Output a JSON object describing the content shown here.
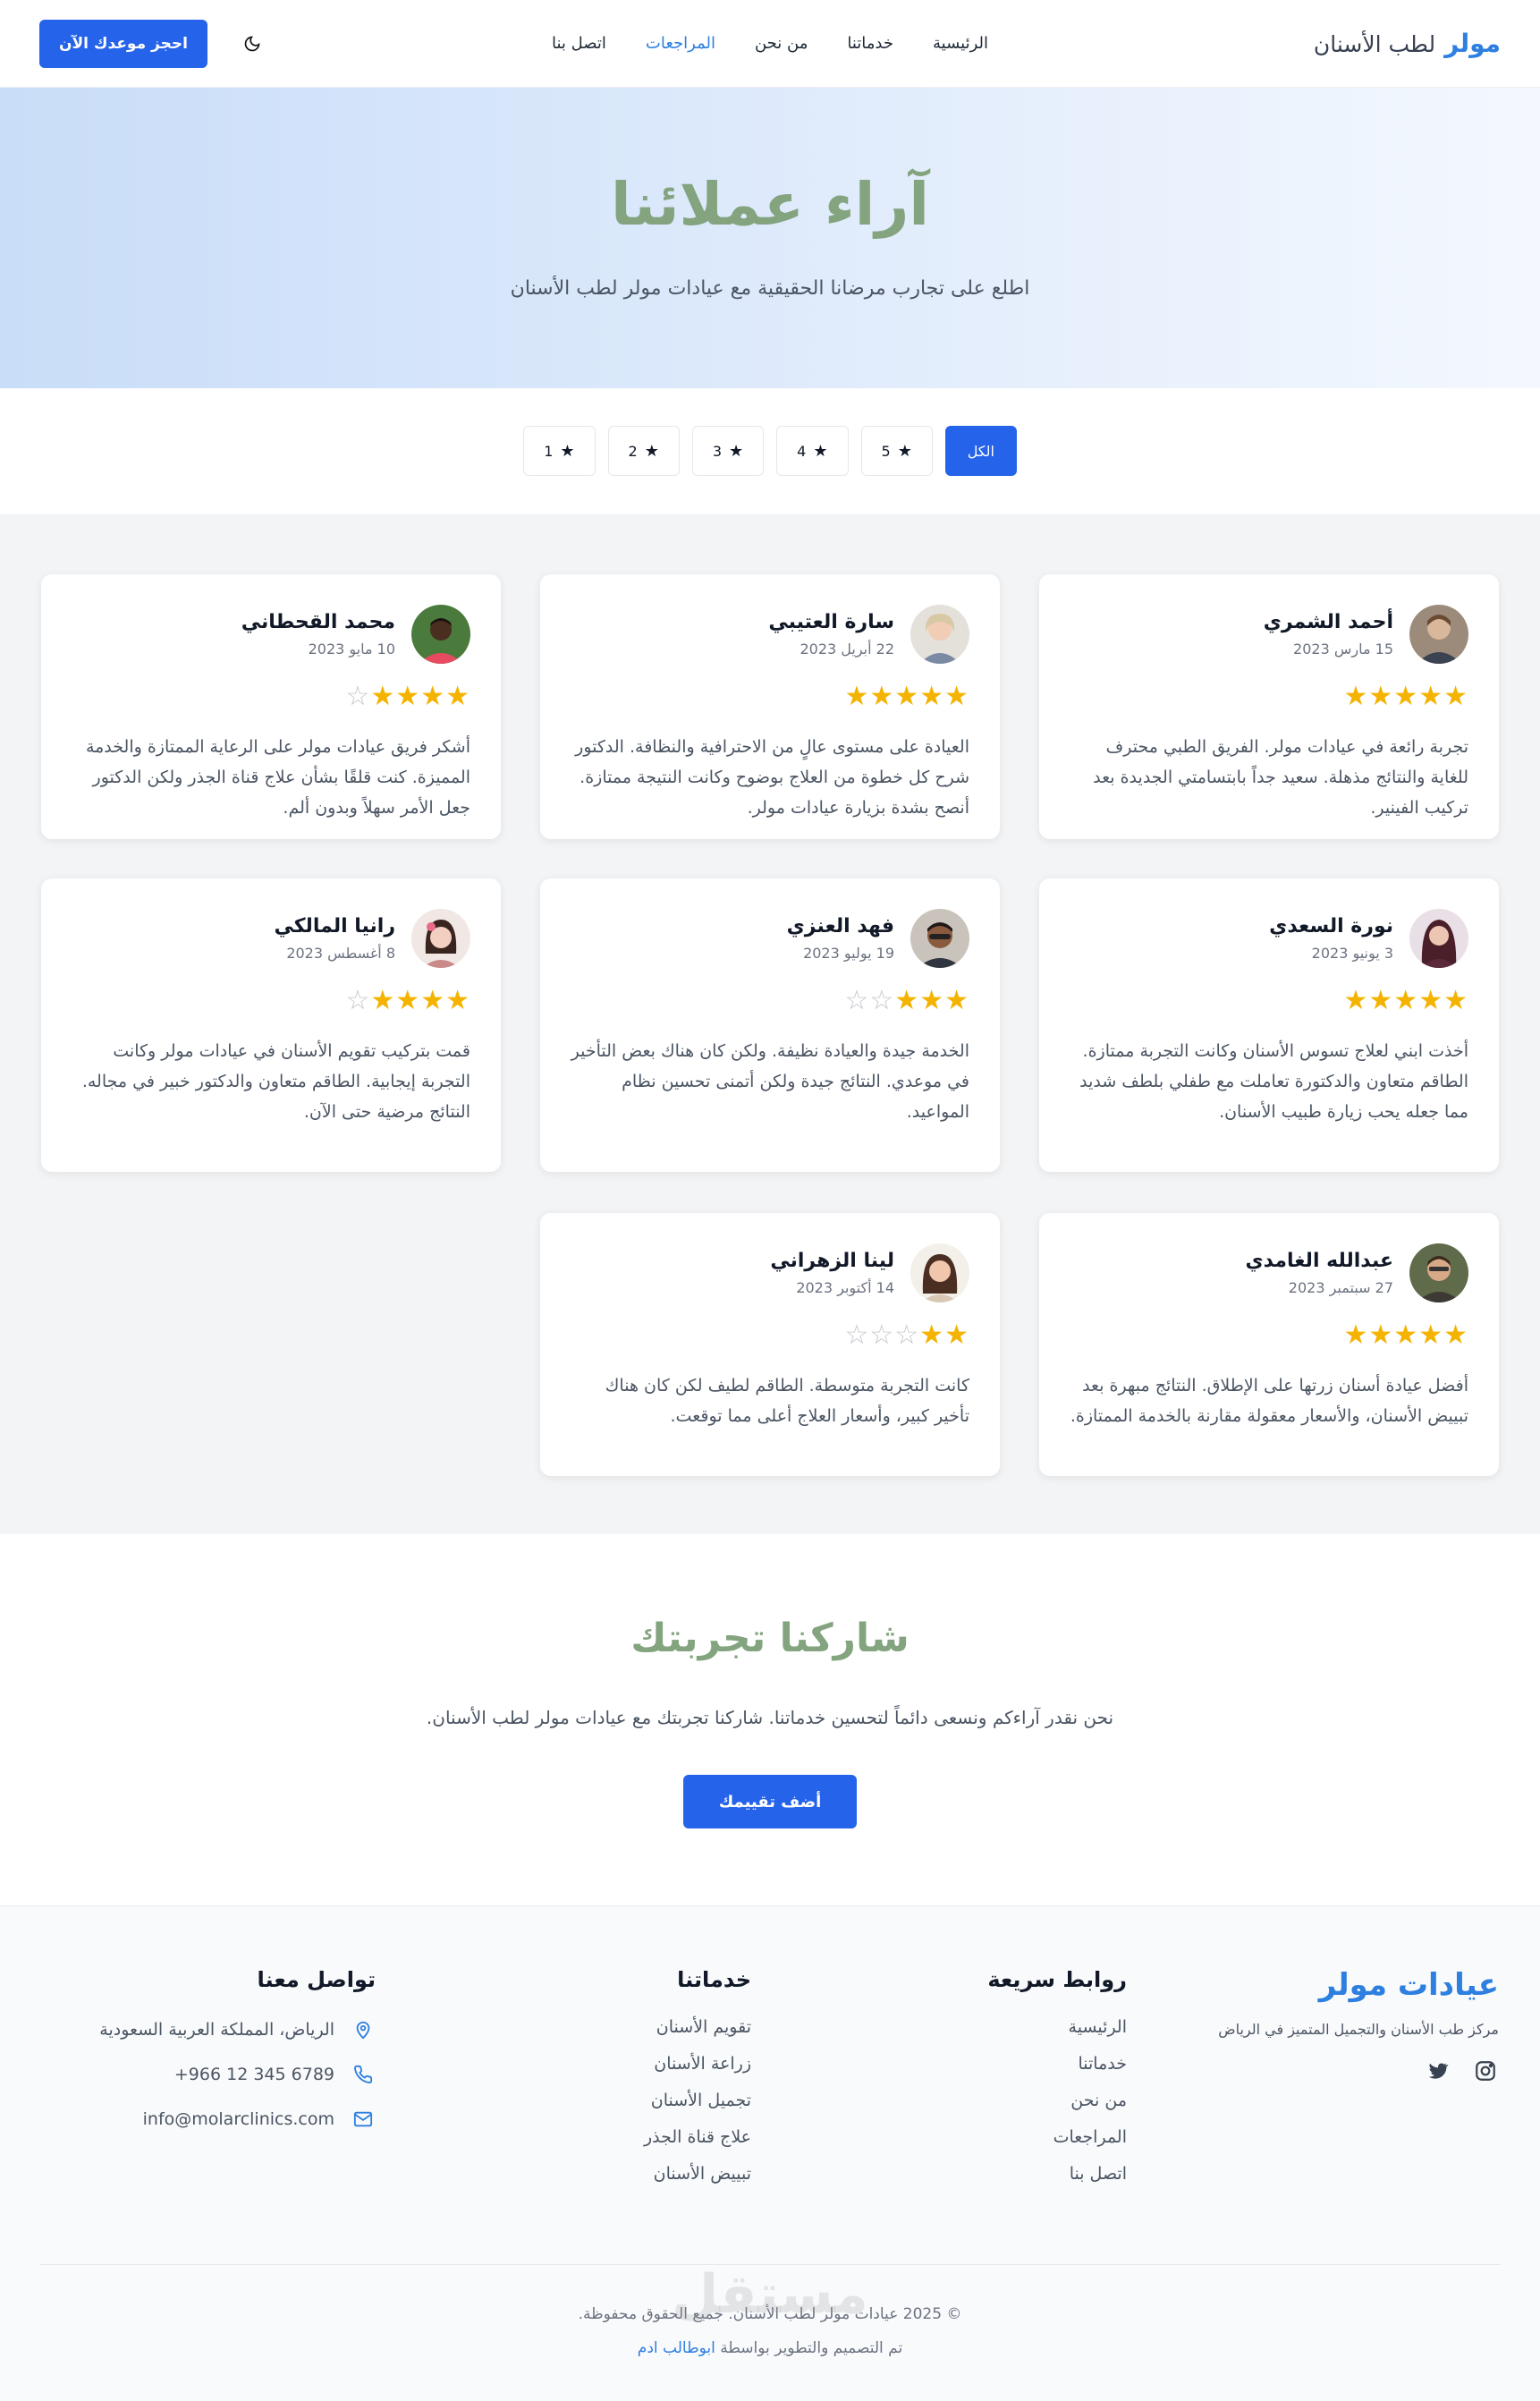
{
  "nav": {
    "brand_main": "مولر",
    "brand_sub": "لطب الأسنان",
    "links": [
      "الرئيسية",
      "خدماتنا",
      "من نحن",
      "المراجعات",
      "اتصل بنا"
    ],
    "active_link": "المراجعات",
    "book_button": "احجز موعدك الآن",
    "theme_icon": "moon-icon"
  },
  "hero": {
    "title": "آراء عملائنا",
    "subtitle": "اطلع على تجارب مرضانا الحقيقية مع عيادات مولر لطب الأسنان"
  },
  "filters": [
    "الكل",
    "5",
    "4",
    "3",
    "2",
    "1"
  ],
  "reviews": [
    {
      "name": "أحمد الشمري",
      "date": "15 مارس 2023",
      "rating": 5,
      "text": "تجربة رائعة في عيادات مولر. الفريق الطبي محترف للغاية والنتائج مذهلة. سعيد جداً بابتسامتي الجديدة بعد تركيب الفينير."
    },
    {
      "name": "سارة العتيبي",
      "date": "22 أبريل 2023",
      "rating": 5,
      "text": "العيادة على مستوى عالٍ من الاحترافية والنظافة. الدكتور شرح كل خطوة من العلاج بوضوح وكانت النتيجة ممتازة. أنصح بشدة بزيارة عيادات مولر."
    },
    {
      "name": "محمد القحطاني",
      "date": "10 مايو 2023",
      "rating": 4,
      "text": "أشكر فريق عيادات مولر على الرعاية الممتازة والخدمة المميزة. كنت قلقًا بشأن علاج قناة الجذر ولكن الدكتور جعل الأمر سهلاً وبدون ألم."
    },
    {
      "name": "نورة السعدي",
      "date": "3 يونيو 2023",
      "rating": 5,
      "text": "أخذت ابني لعلاج تسوس الأسنان وكانت التجربة ممتازة. الطاقم متعاون والدكتورة تعاملت مع طفلي بلطف شديد مما جعله يحب زيارة طبيب الأسنان."
    },
    {
      "name": "فهد العنزي",
      "date": "19 يوليو 2023",
      "rating": 3,
      "text": "الخدمة جيدة والعيادة نظيفة. ولكن كان هناك بعض التأخير في موعدي. النتائج جيدة ولكن أتمنى تحسين نظام المواعيد."
    },
    {
      "name": "رانيا المالكي",
      "date": "8 أغسطس 2023",
      "rating": 4,
      "text": "قمت بتركيب تقويم الأسنان في عيادات مولر وكانت التجربة إيجابية. الطاقم متعاون والدكتور خبير في مجاله. النتائج مرضية حتى الآن."
    },
    {
      "name": "عبدالله الغامدي",
      "date": "27 سبتمبر 2023",
      "rating": 5,
      "text": "أفضل عيادة أسنان زرتها على الإطلاق. النتائج مبهرة بعد تبييض الأسنان، والأسعار معقولة مقارنة بالخدمة الممتازة."
    },
    {
      "name": "لينا الزهراني",
      "date": "14 أكتوبر 2023",
      "rating": 2,
      "text": "كانت التجربة متوسطة. الطاقم لطيف لكن كان هناك تأخير كبير، وأسعار العلاج أعلى مما توقعت."
    }
  ],
  "share": {
    "title": "شاركنا تجربتك",
    "text": "نحن نقدر آراءكم ونسعى دائماً لتحسين خدماتنا. شاركنا تجربتك مع عيادات مولر لطب الأسنان.",
    "button": "أضف تقييمك"
  },
  "footer": {
    "brand_title": "عيادات مولر",
    "brand_desc": "مركز طب الأسنان والتجميل المتميز في الرياض",
    "quick_links_title": "روابط سريعة",
    "quick_links": [
      "الرئيسية",
      "خدماتنا",
      "من نحن",
      "المراجعات",
      "اتصل بنا"
    ],
    "services_title": "خدماتنا",
    "services": [
      "تقويم الأسنان",
      "زراعة الأسنان",
      "تجميل الأسنان",
      "علاج قناة الجذر",
      "تبييض الأسنان"
    ],
    "contact_title": "تواصل معنا",
    "address": "الرياض، المملكة العربية السعودية",
    "phone": "+966 12 345 6789",
    "email": "info@molarclinics.com",
    "copyright": "© 2025 عيادات مولر لطب الأسنان. جميع الحقوق محفوظة.",
    "credit_prefix": "تم التصميم والتطوير بواسطة",
    "credit_name": "ابوطالب ادم"
  },
  "watermark": "مستقل",
  "colors": {
    "accent": "#2563eb",
    "brand": "#2d7fe0",
    "title_green": "#83a47f",
    "star": "#f5b301"
  }
}
